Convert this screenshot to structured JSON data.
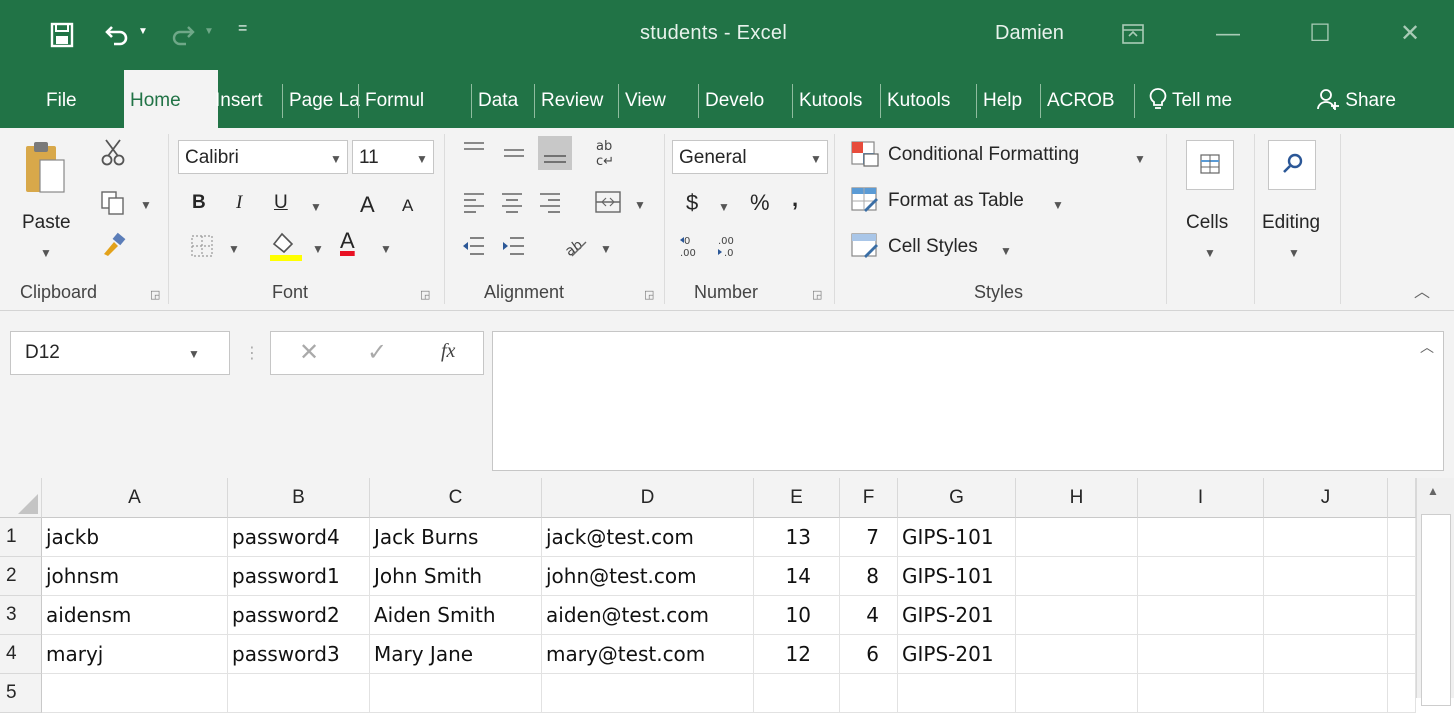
{
  "window": {
    "title": "students - Excel",
    "user": "Damien"
  },
  "qat": {
    "save_icon": "save-icon",
    "undo_icon": "undo-icon",
    "redo_icon": "redo-icon",
    "customize_icon": "customize-qat-icon"
  },
  "ribbon_tabs": [
    "File",
    "Home",
    "Insert",
    "Page La",
    "Formul",
    "Data",
    "Review",
    "View",
    "Develo",
    "Kutools",
    "Kutools",
    "Help",
    "ACROB"
  ],
  "tell_me": "Tell me",
  "share": "Share",
  "clipboard": {
    "paste": "Paste",
    "label": "Clipboard"
  },
  "font": {
    "name": "Calibri",
    "size": "11",
    "bold": "B",
    "italic": "I",
    "underline": "U",
    "grow": "A",
    "shrink": "A",
    "color_letter": "A",
    "label": "Font"
  },
  "alignment": {
    "label": "Alignment"
  },
  "number": {
    "format": "General",
    "currency": "$",
    "percent": "%",
    "comma": ",",
    "label": "Number"
  },
  "styles": {
    "conditional": "Conditional Formatting",
    "format_table": "Format as Table",
    "cell_styles": "Cell Styles",
    "label": "Styles"
  },
  "cells": {
    "label": "Cells"
  },
  "editing": {
    "label": "Editing"
  },
  "formula_bar": {
    "name_box": "D12",
    "fx": "fx",
    "value": ""
  },
  "colors": {
    "excel_green": "#217346",
    "ribbon_bg": "#f3f3f3",
    "font_highlight": "#ffff00",
    "font_color": "#e81123"
  },
  "sheet": {
    "columns": [
      "A",
      "B",
      "C",
      "D",
      "E",
      "F",
      "G",
      "H",
      "I",
      "J"
    ],
    "row_numbers": [
      "1",
      "2",
      "3",
      "4",
      "5"
    ],
    "rows": [
      [
        "jackb",
        "password4",
        "Jack Burns",
        "jack@test.com",
        "13",
        "7",
        "GIPS-101",
        "",
        "",
        ""
      ],
      [
        "johnsm",
        "password1",
        "John Smith",
        "john@test.com",
        "14",
        "8",
        "GIPS-101",
        "",
        "",
        ""
      ],
      [
        "aidensm",
        "password2",
        "Aiden Smith",
        "aiden@test.com",
        "10",
        "4",
        "GIPS-201",
        "",
        "",
        ""
      ],
      [
        "maryj",
        "password3",
        "Mary Jane",
        "mary@test.com",
        "12",
        "6",
        "GIPS-201",
        "",
        "",
        ""
      ],
      [
        "",
        "",
        "",
        "",
        "",
        "",
        "",
        "",
        "",
        ""
      ]
    ]
  }
}
